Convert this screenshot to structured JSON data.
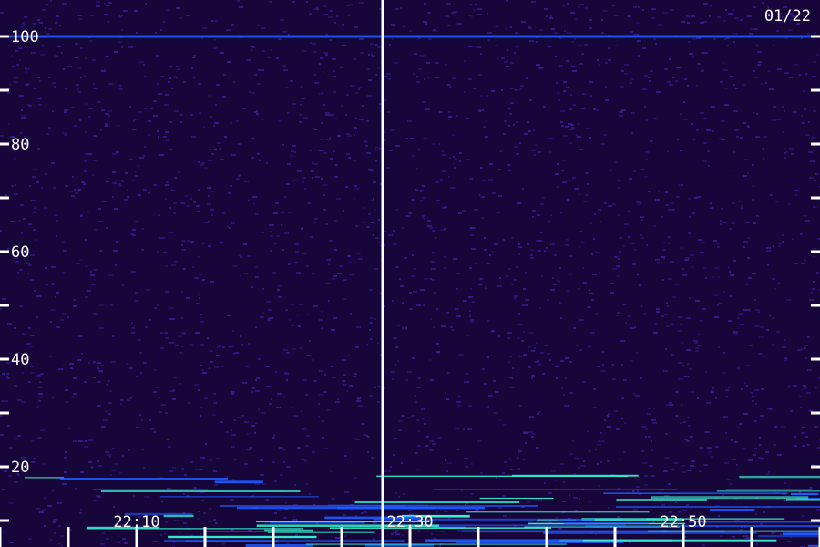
{
  "chart_data": {
    "type": "heatmap",
    "title": "",
    "date_label": "01/22",
    "xlabel": "",
    "ylabel": "",
    "x_tick_labels": [
      {
        "value": "22:10",
        "label": "22:10"
      },
      {
        "value": "22:30",
        "label": "22:30"
      },
      {
        "value": "22:50",
        "label": "22:50"
      }
    ],
    "x_minor_ticks_minutes": 5,
    "y_tick_labels": [
      {
        "value": 20,
        "label": "20"
      },
      {
        "value": 40,
        "label": "40"
      },
      {
        "value": 60,
        "label": "60"
      },
      {
        "value": 80,
        "label": "80"
      },
      {
        "value": 100,
        "label": "100"
      }
    ],
    "y_minor_ticks": [
      10,
      30,
      50,
      70,
      90
    ],
    "separator_time": "22:28",
    "persistent_line_value": 100,
    "colors": {
      "background": "#17063a",
      "noise": "#3d1ea0",
      "signal_low": "#1e5aff",
      "signal_high": "#38f0d0",
      "axis": "#ffffff"
    }
  }
}
